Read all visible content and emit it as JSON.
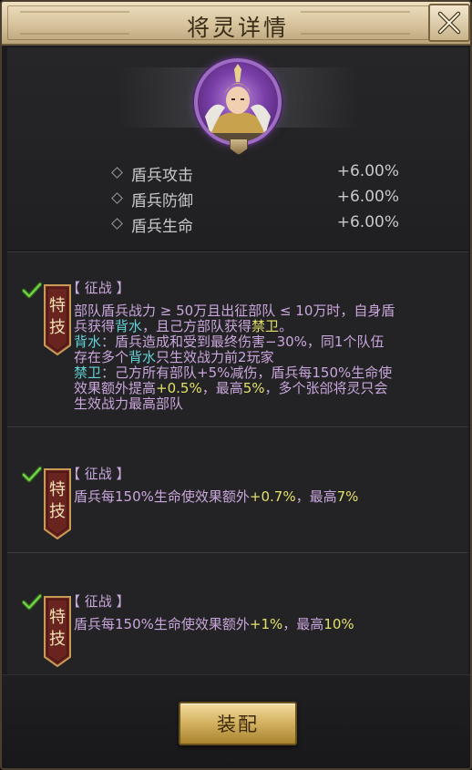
{
  "window": {
    "title": "将灵详情",
    "close_icon": "close-icon"
  },
  "general": {
    "portrait_icon": "general-portrait"
  },
  "attributes": [
    {
      "name": "盾兵攻击",
      "value": "+6.00%"
    },
    {
      "name": "盾兵防御",
      "value": "+6.00%"
    },
    {
      "name": "盾兵生命",
      "value": "+6.00%"
    }
  ],
  "skills": [
    {
      "badge": [
        "特",
        "技"
      ],
      "tag": "【 征战 】",
      "lines": [
        {
          "segments": [
            {
              "t": "部队盾兵战力 ≥ 50万且出征部队 ≤ 10万时，自身盾",
              "c": "tag"
            }
          ]
        },
        {
          "segments": [
            {
              "t": "兵获得",
              "c": "tag"
            },
            {
              "t": "背水",
              "c": "kw"
            },
            {
              "t": "，且己方部队获得",
              "c": "tag"
            },
            {
              "t": "禁卫",
              "c": "hl"
            },
            {
              "t": "。",
              "c": "tag"
            }
          ]
        },
        {
          "segments": [
            {
              "t": "背水",
              "c": "kw"
            },
            {
              "t": "：盾兵造成和受到最终伤害−30%，同1个队伍",
              "c": "tag"
            }
          ]
        },
        {
          "segments": [
            {
              "t": "存在多个",
              "c": "tag"
            },
            {
              "t": "背水",
              "c": "kw"
            },
            {
              "t": "只生效战力前2玩家",
              "c": "tag"
            }
          ]
        },
        {
          "segments": [
            {
              "t": "禁卫",
              "c": "kw"
            },
            {
              "t": "：己方所有部队+5%减伤，盾兵每150%生命使",
              "c": "tag"
            }
          ]
        },
        {
          "segments": [
            {
              "t": "效果额外提高",
              "c": "tag"
            },
            {
              "t": "+0.5%",
              "c": "hl"
            },
            {
              "t": "，最高",
              "c": "tag"
            },
            {
              "t": "5%",
              "c": "hl"
            },
            {
              "t": "，多个张郃将灵只会",
              "c": "tag"
            }
          ]
        },
        {
          "segments": [
            {
              "t": "生效战力最高部队",
              "c": "tag"
            }
          ]
        }
      ]
    },
    {
      "badge": [
        "特",
        "技"
      ],
      "tag": "【 征战 】",
      "lines": [
        {
          "segments": [
            {
              "t": "盾兵每150%生命使效果额外",
              "c": "tag"
            },
            {
              "t": "+0.7%",
              "c": "hl"
            },
            {
              "t": "，最高",
              "c": "tag"
            },
            {
              "t": "7%",
              "c": "hl"
            }
          ]
        }
      ]
    },
    {
      "badge": [
        "特",
        "技"
      ],
      "tag": "【 征战 】",
      "lines": [
        {
          "segments": [
            {
              "t": "盾兵每150%生命使效果额外",
              "c": "tag"
            },
            {
              "t": "+1%",
              "c": "hl"
            },
            {
              "t": "，最高",
              "c": "tag"
            },
            {
              "t": "10%",
              "c": "hl"
            }
          ]
        }
      ]
    }
  ],
  "footer": {
    "equip_label": "装配"
  },
  "colors": {
    "keyword": "#62d1d6",
    "highlight": "#e3e06a",
    "body_text": "#c9a6dc",
    "attribute_text": "#c9c9cc",
    "check": "#5fbf3a"
  }
}
